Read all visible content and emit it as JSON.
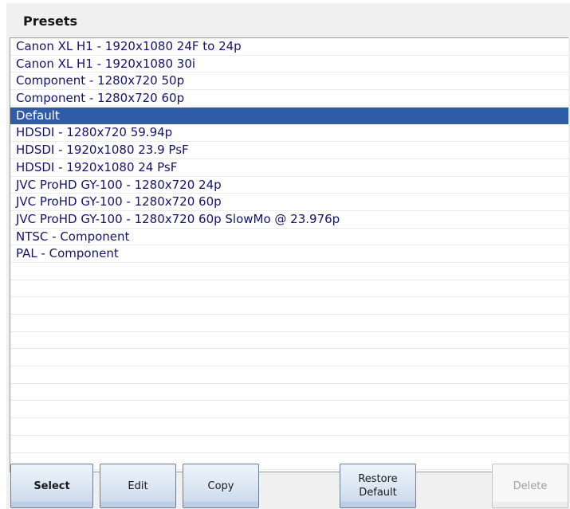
{
  "panel": {
    "title": "Presets"
  },
  "presets": {
    "selected_index": 4,
    "items": [
      "Canon XL H1 - 1920x1080 24F to 24p",
      "Canon XL H1 - 1920x1080 30i",
      "Component - 1280x720 50p",
      "Component - 1280x720 60p",
      "Default",
      "HDSDI - 1280x720 59.94p",
      "HDSDI - 1920x1080 23.9 PsF",
      "HDSDI - 1920x1080 24 PsF",
      "JVC ProHD GY-100 - 1280x720 24p",
      "JVC ProHD GY-100 - 1280x720 60p",
      "JVC ProHD GY-100 - 1280x720 60p SlowMo @ 23.976p",
      "NTSC - Component",
      "PAL - Component"
    ]
  },
  "buttons": {
    "select": "Select",
    "edit": "Edit",
    "copy": "Copy",
    "restore_default": "Restore\nDefault",
    "delete": "Delete"
  },
  "colors": {
    "selection": "#2e5ca6",
    "item_text": "#14146b"
  }
}
